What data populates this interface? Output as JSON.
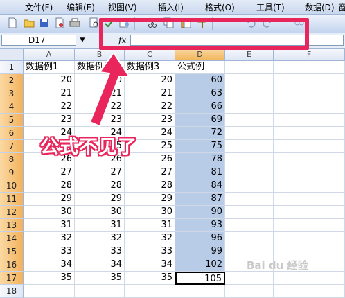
{
  "menu": [
    "文件(F)",
    "编辑(E)",
    "视图(V)",
    "插入(I)",
    "格式(O)",
    "工具(T)",
    "数据(D)",
    "窗"
  ],
  "toolbar_icons": [
    "new-icon",
    "open-icon",
    "save-icon",
    "permission-icon",
    "print-icon",
    "print-preview-icon",
    "spellcheck-icon",
    "research-icon",
    "cut-icon",
    "copy-icon",
    "paste-icon",
    "format-painter-icon",
    "undo-icon",
    "redo-icon",
    "hyperlink-icon"
  ],
  "formula_bar": {
    "name_box": "D17",
    "fx_label": "fx",
    "formula": ""
  },
  "columns": [
    "A",
    "B",
    "C",
    "D",
    "E",
    "F"
  ],
  "rows": [
    {
      "n": "1",
      "a": "数据例1",
      "b": "数据例2",
      "c": "数据例3",
      "d": "公式例"
    },
    {
      "n": "2",
      "a": "20",
      "b": "20",
      "c": "20",
      "d": "60"
    },
    {
      "n": "3",
      "a": "21",
      "b": "21",
      "c": "21",
      "d": "63"
    },
    {
      "n": "4",
      "a": "22",
      "b": "22",
      "c": "22",
      "d": "66"
    },
    {
      "n": "5",
      "a": "23",
      "b": "23",
      "c": "23",
      "d": "69"
    },
    {
      "n": "6",
      "a": "24",
      "b": "24",
      "c": "24",
      "d": "72"
    },
    {
      "n": "7",
      "a": "25",
      "b": "25",
      "c": "25",
      "d": "75"
    },
    {
      "n": "8",
      "a": "26",
      "b": "26",
      "c": "26",
      "d": "78"
    },
    {
      "n": "9",
      "a": "27",
      "b": "27",
      "c": "27",
      "d": "81"
    },
    {
      "n": "10",
      "a": "28",
      "b": "28",
      "c": "28",
      "d": "84"
    },
    {
      "n": "11",
      "a": "29",
      "b": "29",
      "c": "29",
      "d": "87"
    },
    {
      "n": "12",
      "a": "30",
      "b": "30",
      "c": "30",
      "d": "90"
    },
    {
      "n": "13",
      "a": "31",
      "b": "31",
      "c": "31",
      "d": "93"
    },
    {
      "n": "14",
      "a": "32",
      "b": "32",
      "c": "32",
      "d": "96"
    },
    {
      "n": "15",
      "a": "33",
      "b": "33",
      "c": "33",
      "d": "99"
    },
    {
      "n": "16",
      "a": "34",
      "b": "34",
      "c": "34",
      "d": "102"
    },
    {
      "n": "17",
      "a": "35",
      "b": "35",
      "c": "35",
      "d": "105"
    },
    {
      "n": "18",
      "a": "",
      "b": "",
      "c": "",
      "d": ""
    }
  ],
  "annotation": {
    "text": "公式不见了",
    "color": "#e8265c"
  },
  "watermark": "Bai du 经验"
}
